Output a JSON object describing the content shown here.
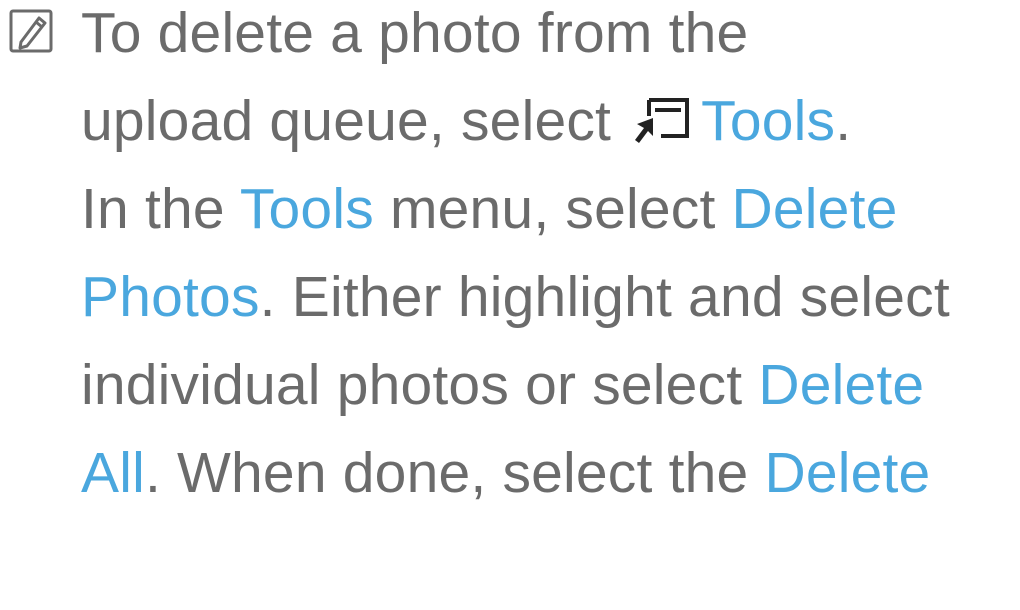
{
  "icons": {
    "note": "memo-note-icon",
    "tools": "tools-remote-icon"
  },
  "colors": {
    "body_text": "#6b6b6b",
    "highlight": "#4aa7de"
  },
  "lines": {
    "l1": {
      "t1": "To delete a photo from the"
    },
    "l2": {
      "t1": "upload queue, select ",
      "h1": "Tools",
      "t2": "."
    },
    "l3": {
      "t1": "In the ",
      "h1": "Tools",
      "t2": " menu, select ",
      "h2": "Delete"
    },
    "l4": {
      "h1": "Photos",
      "t1": ". Either highlight and select"
    },
    "l5": {
      "t1": "individual photos or select ",
      "h1": "Delete"
    },
    "l6": {
      "h1": "All",
      "t1": ". When done, select the ",
      "h2": "Delete"
    }
  }
}
